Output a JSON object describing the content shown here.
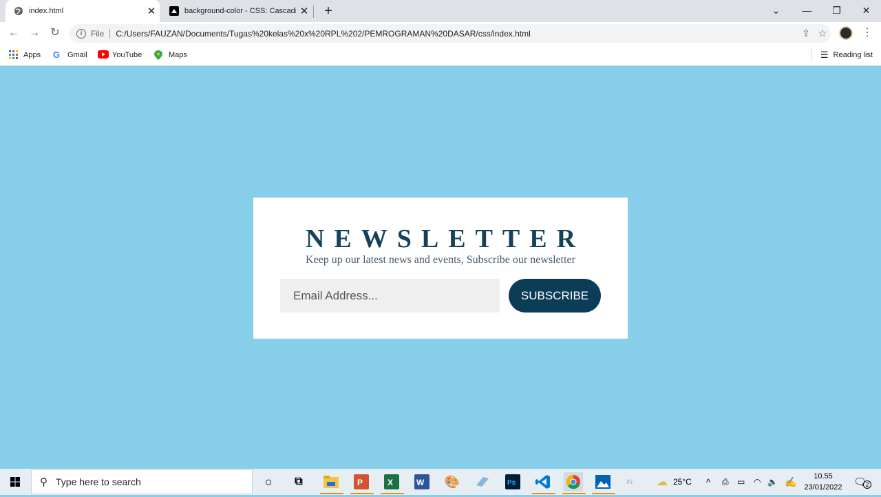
{
  "browser": {
    "tabs": [
      {
        "title": "index.html",
        "active": true
      },
      {
        "title": "background-color - CSS: Cascadi",
        "active": false
      }
    ],
    "new_tab_label": "+",
    "omnibox": {
      "scheme_label": "File",
      "url": "C:/Users/FAUZAN/Documents/Tugas%20kelas%20x%20RPL%202/PEMROGRAMAN%20DASAR/css/index.html"
    },
    "bookmarks": [
      {
        "label": "Apps",
        "icon": "apps-grid-icon"
      },
      {
        "label": "Gmail",
        "icon": "google-icon"
      },
      {
        "label": "YouTube",
        "icon": "youtube-icon"
      },
      {
        "label": "Maps",
        "icon": "maps-pin-icon"
      }
    ],
    "reading_list_label": "Reading list"
  },
  "page": {
    "background_color": "#87ceeb",
    "newsletter": {
      "title": "NEWSLETTER",
      "subtitle": "Keep up our latest news and events, Subscribe our newsletter",
      "email_placeholder": "Email Address...",
      "subscribe_label": "SUBSCRIBE",
      "title_color": "#15425a",
      "button_color": "#0b3d56"
    }
  },
  "taskbar": {
    "search_placeholder": "Type here to search",
    "apps": [
      "cortana-icon",
      "task-view-icon",
      "file-explorer-icon",
      "powerpoint-icon",
      "excel-icon",
      "word-icon",
      "paint-icon",
      "notepad-icon",
      "photoshop-icon",
      "vscode-icon",
      "chrome-icon",
      "photos-icon"
    ],
    "ime": "IN",
    "temperature": "25°C",
    "time": "10.55",
    "date": "23/01/2022",
    "notification_count": "2"
  }
}
